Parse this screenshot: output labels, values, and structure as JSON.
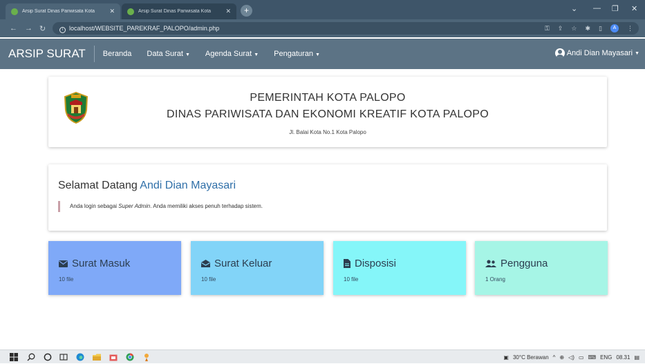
{
  "browser": {
    "tabs": [
      {
        "title": "Arsip Surat Dinas Pariwisata Kota"
      },
      {
        "title": "Arsip Surat Dinas Pariwisata Kota"
      }
    ],
    "url": "localhost/WEBSITE_PAREKRAF_PALOPO/admin.php",
    "profile_initial": "A"
  },
  "navbar": {
    "brand": "ARSIP SURAT",
    "items": [
      {
        "label": "Beranda"
      },
      {
        "label": "Data Surat"
      },
      {
        "label": "Agenda Surat"
      },
      {
        "label": "Pengaturan"
      }
    ],
    "user_name": "Andi Dian Mayasari"
  },
  "header": {
    "line1": "PEMERINTAH KOTA PALOPO",
    "line2": "DINAS PARIWISATA DAN EKONOMI KREATIF KOTA PALOPO",
    "address": "Jl. Balai Kota No.1 Kota Palopo"
  },
  "welcome": {
    "greeting": "Selamat Datang",
    "name": "Andi Dian Mayasari",
    "note_prefix": "Anda login sebagai",
    "role": "Super Admin",
    "note_suffix": ". Anda memiliki akses penuh terhadap sistem."
  },
  "tiles": [
    {
      "title": "Surat Masuk",
      "sub": "10 file",
      "icon": "envelope-icon",
      "color": "#7fa9f8"
    },
    {
      "title": "Surat Keluar",
      "sub": "10 file",
      "icon": "envelope-open-icon",
      "color": "#82d4f8"
    },
    {
      "title": "Disposisi",
      "sub": "10 file",
      "icon": "file-icon",
      "color": "#85f6f9"
    },
    {
      "title": "Pengguna",
      "sub": "1 Orang",
      "icon": "users-icon",
      "color": "#a6f5e6"
    }
  ],
  "taskbar": {
    "weather": "30°C Berawan",
    "lang": "ENG",
    "time": "08.31"
  }
}
